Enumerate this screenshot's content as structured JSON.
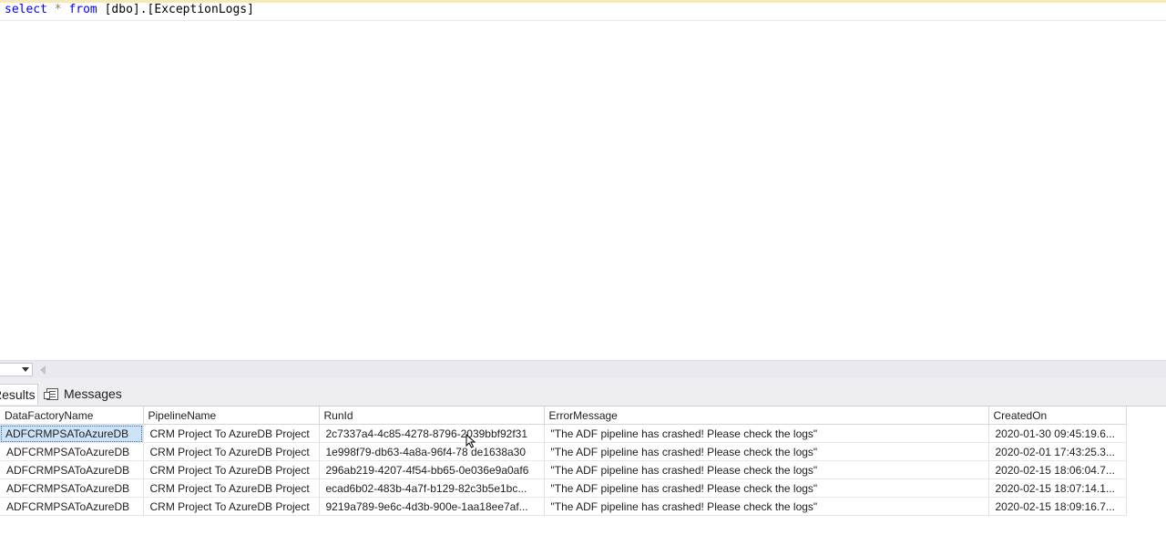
{
  "editor": {
    "query_keyword_select": "select",
    "query_star": "*",
    "query_keyword_from": "from",
    "query_object": "[dbo].[ExceptionLogs]"
  },
  "tabs": {
    "results_label": "Results",
    "messages_label": "Messages"
  },
  "grid": {
    "columns": [
      "DataFactoryName",
      "PipelineName",
      "RunId",
      "ErrorMessage",
      "CreatedOn"
    ],
    "rows": [
      [
        "ADFCRMPSAToAzureDB",
        "CRM Project To AzureDB Project",
        "2c7337a4-4c85-4278-8796-2039bbf92f31",
        "\"The ADF pipeline has crashed! Please check the logs\"",
        "2020-01-30 09:45:19.6..."
      ],
      [
        "ADFCRMPSAToAzureDB",
        "CRM Project To AzureDB Project",
        "1e998f79-db63-4a8a-96f4-78 de1638a30",
        "\"The ADF pipeline has crashed! Please check the logs\"",
        "2020-02-01 17:43:25.3..."
      ],
      [
        "ADFCRMPSAToAzureDB",
        "CRM Project To AzureDB Project",
        "296ab219-4207-4f54-bb65-0e036e9a0af6",
        "\"The ADF pipeline has crashed! Please check the logs\"",
        "2020-02-15 18:06:04.7..."
      ],
      [
        "ADFCRMPSAToAzureDB",
        "CRM Project To AzureDB Project",
        "ecad6b02-483b-4a7f-b129-82c3b5e1bc...",
        "\"The ADF pipeline has crashed! Please check the logs\"",
        "2020-02-15 18:07:14.1..."
      ],
      [
        "ADFCRMPSAToAzureDB",
        "CRM Project To AzureDB Project",
        "9219a789-9e6c-4d3b-900e-1aa18ee7af...",
        "\"The ADF pipeline has crashed! Please check the logs\"",
        "2020-02-15 18:09:16.7..."
      ]
    ]
  },
  "colors": {
    "keyword": "#0000ff",
    "operator": "#808080",
    "selected_cell": "#cde3f7"
  }
}
